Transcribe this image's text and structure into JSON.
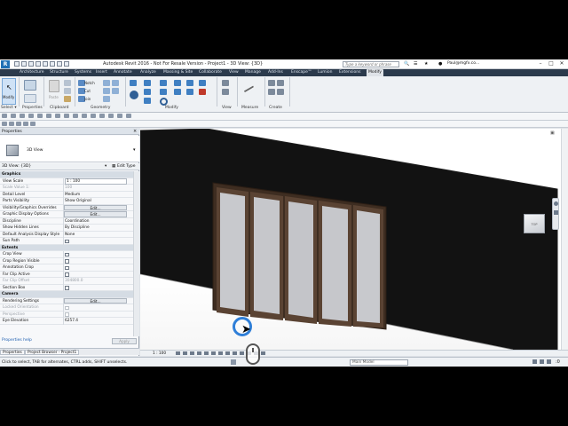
{
  "title_bar": {
    "logo": "R",
    "title": "Autodesk Revit 2016 - Not For Resale Version -   Project1 - 3D View: {3D}",
    "search_placeholder": "Type a keyword or phrase",
    "user": "Paul@mgfx.co...",
    "minimize": "–",
    "restore": "□",
    "close": "✕"
  },
  "tabs": [
    "Architecture",
    "Structure",
    "Systems",
    "Insert",
    "Annotate",
    "Analyze",
    "Massing & Site",
    "Collaborate",
    "View",
    "Manage",
    "Add-Ins",
    "Enscape™",
    "Lumion",
    "Extensions",
    "Modify"
  ],
  "active_tab": "Modify",
  "ribbon": {
    "modify_label": "Modify",
    "panels": [
      "Select ▾",
      "Properties",
      "Clipboard",
      "Geometry",
      "Modify",
      "View",
      "Measure",
      "Create"
    ],
    "geometry_tools": [
      "Notch",
      "Cut",
      "Join"
    ],
    "paste_label": "Paste"
  },
  "properties": {
    "title": "Properties",
    "close": "×",
    "type_name": "3D View",
    "view_selector": "3D View: {3D}",
    "edit_type": "Edit Type",
    "groups": [
      {
        "name": "Graphics",
        "rows": [
          {
            "key": "View Scale",
            "value": "1 : 100",
            "kind": "field"
          },
          {
            "key": "Scale Value    1:",
            "value": "100",
            "kind": "dim"
          },
          {
            "key": "Detail Level",
            "value": "Medium",
            "kind": "text"
          },
          {
            "key": "Parts Visibility",
            "value": "Show Original",
            "kind": "text"
          },
          {
            "key": "Visibility/Graphics Overrides",
            "value": "Edit...",
            "kind": "button"
          },
          {
            "key": "Graphic Display Options",
            "value": "Edit...",
            "kind": "button"
          },
          {
            "key": "Discipline",
            "value": "Coordination",
            "kind": "text"
          },
          {
            "key": "Show Hidden Lines",
            "value": "By Discipline",
            "kind": "text"
          },
          {
            "key": "Default Analysis Display Style",
            "value": "None",
            "kind": "text"
          },
          {
            "key": "Sun Path",
            "value": "",
            "kind": "check"
          }
        ]
      },
      {
        "name": "Extents",
        "rows": [
          {
            "key": "Crop View",
            "value": "",
            "kind": "check"
          },
          {
            "key": "Crop Region Visible",
            "value": "",
            "kind": "check"
          },
          {
            "key": "Annotation Crop",
            "value": "",
            "kind": "check"
          },
          {
            "key": "Far Clip Active",
            "value": "",
            "kind": "check"
          },
          {
            "key": "Far Clip Offset",
            "value": "304800.0",
            "kind": "dim"
          },
          {
            "key": "Section Box",
            "value": "",
            "kind": "check"
          }
        ]
      },
      {
        "name": "Camera",
        "rows": [
          {
            "key": "Rendering Settings",
            "value": "Edit...",
            "kind": "button"
          },
          {
            "key": "Locked Orientation",
            "value": "",
            "kind": "checkdim"
          },
          {
            "key": "Perspective",
            "value": "",
            "kind": "checkdim"
          },
          {
            "key": "Eye Elevation",
            "value": "6257.4",
            "kind": "text"
          }
        ]
      }
    ],
    "help_link": "Properties help",
    "apply": "Apply"
  },
  "browser_tabs": [
    "Properties",
    "Project Browser - Project1"
  ],
  "viewport": {
    "viewcube_label": "TOP",
    "scale": "1 : 100",
    "close": "▣",
    "colors": {
      "wall": "#121212",
      "frame": "#4a3526",
      "glass": "#c8c9cd"
    }
  },
  "status": {
    "message": "Click to select, TAB for alternates, CTRL adds, SHIFT unselects.",
    "model": "Main Model"
  }
}
